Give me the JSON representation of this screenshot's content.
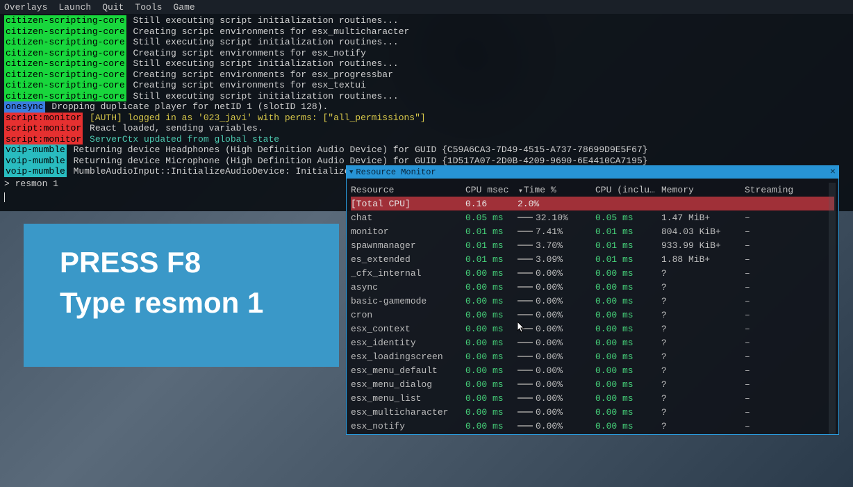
{
  "menubar": {
    "items": [
      "Overlays",
      "Launch",
      "Quit",
      "Tools",
      "Game"
    ]
  },
  "console": {
    "lines": [
      {
        "tag": "citizen-scripting-core",
        "tagClass": "green",
        "msg": "Still executing script initialization routines..."
      },
      {
        "tag": "citizen-scripting-core",
        "tagClass": "green",
        "msg": "Creating script environments for esx_multicharacter"
      },
      {
        "tag": "citizen-scripting-core",
        "tagClass": "green",
        "msg": "Still executing script initialization routines..."
      },
      {
        "tag": "citizen-scripting-core",
        "tagClass": "green",
        "msg": "Creating script environments for esx_notify"
      },
      {
        "tag": "citizen-scripting-core",
        "tagClass": "green",
        "msg": "Still executing script initialization routines..."
      },
      {
        "tag": "citizen-scripting-core",
        "tagClass": "green",
        "msg": "Creating script environments for esx_progressbar"
      },
      {
        "tag": "citizen-scripting-core",
        "tagClass": "green",
        "msg": "Creating script environments for esx_textui"
      },
      {
        "tag": "citizen-scripting-core",
        "tagClass": "green",
        "msg": "Still executing script initialization routines..."
      },
      {
        "tag": "onesync",
        "tagClass": "blue",
        "msg": "Dropping duplicate player for netID 1 (slotID 128)."
      },
      {
        "tag": "script:monitor",
        "tagClass": "red",
        "msg": "[AUTH] logged in as '023_javi' with perms: [\"all_permissions\"]",
        "msgClass": "yellow"
      },
      {
        "tag": "script:monitor",
        "tagClass": "red",
        "msg": "React loaded, sending variables."
      },
      {
        "tag": "script:monitor",
        "tagClass": "red",
        "msg": "ServerCtx updated from global state",
        "msgClass": "cyan"
      },
      {
        "tag": "voip-mumble",
        "tagClass": "teal",
        "msg": "Returning device Headphones (High Definition Audio Device) for GUID {C59A6CA3-7D49-4515-A737-78699D9E5F67}"
      },
      {
        "tag": "voip-mumble",
        "tagClass": "teal",
        "msg": "Returning device Microphone (High Definition Audio Device) for GUID {1D517A07-2D0B-4209-9690-6E4410CA7195}"
      },
      {
        "tag": "voip-mumble",
        "tagClass": "teal",
        "msg": "MumbleAudioInput::InitializeAudioDevice: Initialized au"
      }
    ],
    "prompt": "> resmon 1"
  },
  "resmon": {
    "title": "Resource Monitor",
    "columns": [
      "Resource",
      "CPU msec",
      "Time %",
      "CPU (inclu…",
      "Memory",
      "Streaming"
    ],
    "total": {
      "name": "[Total CPU]",
      "cpu_msec": "0.16",
      "time_pct": "2.0%",
      "cpu_inc": "",
      "memory": "",
      "streaming": ""
    },
    "rows": [
      {
        "name": "chat",
        "cpu_msec": "0.05 ms",
        "time_pct": "32.10%",
        "cpu_inc": "0.05 ms",
        "memory": "1.47 MiB+",
        "streaming": "–"
      },
      {
        "name": "monitor",
        "cpu_msec": "0.01 ms",
        "time_pct": "7.41%",
        "cpu_inc": "0.01 ms",
        "memory": "804.03 KiB+",
        "streaming": "–"
      },
      {
        "name": "spawnmanager",
        "cpu_msec": "0.01 ms",
        "time_pct": "3.70%",
        "cpu_inc": "0.01 ms",
        "memory": "933.99 KiB+",
        "streaming": "–"
      },
      {
        "name": "es_extended",
        "cpu_msec": "0.01 ms",
        "time_pct": "3.09%",
        "cpu_inc": "0.01 ms",
        "memory": "1.88 MiB+",
        "streaming": "–"
      },
      {
        "name": "_cfx_internal",
        "cpu_msec": "0.00 ms",
        "time_pct": "0.00%",
        "cpu_inc": "0.00 ms",
        "memory": "?",
        "streaming": "–"
      },
      {
        "name": "async",
        "cpu_msec": "0.00 ms",
        "time_pct": "0.00%",
        "cpu_inc": "0.00 ms",
        "memory": "?",
        "streaming": "–"
      },
      {
        "name": "basic-gamemode",
        "cpu_msec": "0.00 ms",
        "time_pct": "0.00%",
        "cpu_inc": "0.00 ms",
        "memory": "?",
        "streaming": "–"
      },
      {
        "name": "cron",
        "cpu_msec": "0.00 ms",
        "time_pct": "0.00%",
        "cpu_inc": "0.00 ms",
        "memory": "?",
        "streaming": "–"
      },
      {
        "name": "esx_context",
        "cpu_msec": "0.00 ms",
        "time_pct": "0.00%",
        "cpu_inc": "0.00 ms",
        "memory": "?",
        "streaming": "–"
      },
      {
        "name": "esx_identity",
        "cpu_msec": "0.00 ms",
        "time_pct": "0.00%",
        "cpu_inc": "0.00 ms",
        "memory": "?",
        "streaming": "–"
      },
      {
        "name": "esx_loadingscreen",
        "cpu_msec": "0.00 ms",
        "time_pct": "0.00%",
        "cpu_inc": "0.00 ms",
        "memory": "?",
        "streaming": "–"
      },
      {
        "name": "esx_menu_default",
        "cpu_msec": "0.00 ms",
        "time_pct": "0.00%",
        "cpu_inc": "0.00 ms",
        "memory": "?",
        "streaming": "–"
      },
      {
        "name": "esx_menu_dialog",
        "cpu_msec": "0.00 ms",
        "time_pct": "0.00%",
        "cpu_inc": "0.00 ms",
        "memory": "?",
        "streaming": "–"
      },
      {
        "name": "esx_menu_list",
        "cpu_msec": "0.00 ms",
        "time_pct": "0.00%",
        "cpu_inc": "0.00 ms",
        "memory": "?",
        "streaming": "–"
      },
      {
        "name": "esx_multicharacter",
        "cpu_msec": "0.00 ms",
        "time_pct": "0.00%",
        "cpu_inc": "0.00 ms",
        "memory": "?",
        "streaming": "–"
      },
      {
        "name": "esx_notify",
        "cpu_msec": "0.00 ms",
        "time_pct": "0.00%",
        "cpu_inc": "0.00 ms",
        "memory": "?",
        "streaming": "–"
      }
    ]
  },
  "instruction": {
    "line1": "PRESS F8",
    "line2": "Type resmon 1"
  }
}
